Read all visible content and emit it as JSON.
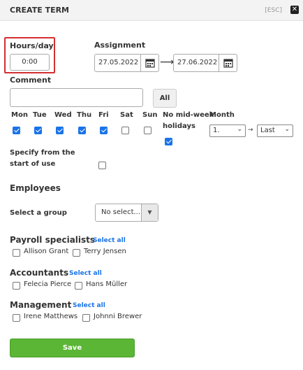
{
  "header": {
    "title": "CREATE TERM",
    "esc_label": "[ESC]",
    "close_icon": "close-icon"
  },
  "hours": {
    "label": "Hours/day",
    "value": "0:00"
  },
  "assignment": {
    "label": "Assignment",
    "start_date": "27.05.2022",
    "end_date": "27.06.2022",
    "arrow": "⟶"
  },
  "comment": {
    "label": "Comment",
    "value": "",
    "all_label": "All"
  },
  "days": [
    {
      "label": "Mon",
      "checked": true
    },
    {
      "label": "Tue",
      "checked": true
    },
    {
      "label": "Wed",
      "checked": true
    },
    {
      "label": "Thu",
      "checked": true
    },
    {
      "label": "Fri",
      "checked": true
    },
    {
      "label": "Sat",
      "checked": false
    },
    {
      "label": "Sun",
      "checked": false
    }
  ],
  "no_midweek": {
    "label_line1": "No mid-week",
    "label_line2": "holidays",
    "checked": true
  },
  "month": {
    "label": "Month",
    "from_value": "1.",
    "to_value": "Last",
    "arrow": "→"
  },
  "specify": {
    "label_line1": "Specify from the",
    "label_line2": "start of use",
    "checked": false
  },
  "employees": {
    "title": "Employees",
    "group_label": "Select a group",
    "group_placeholder": "No select..."
  },
  "groups": [
    {
      "title": "Payroll specialists",
      "select_all": "Select all",
      "members": [
        "Allison Grant",
        "Terry Jensen"
      ]
    },
    {
      "title": "Accountants",
      "select_all": "Select all",
      "members": [
        "Felecia Pierce",
        "Hans Müller"
      ]
    },
    {
      "title": "Management",
      "select_all": "Select all",
      "members": [
        "Irene Matthews",
        "Johnni Brewer"
      ]
    }
  ],
  "save_label": "Save",
  "colors": {
    "accent": "#1a73e8",
    "save": "#5bb636",
    "highlight": "#d32f2f"
  }
}
